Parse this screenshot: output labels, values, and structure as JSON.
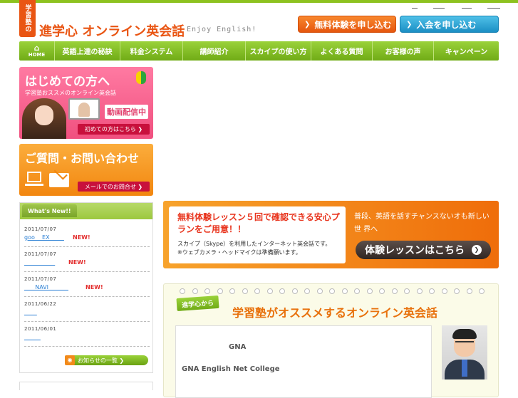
{
  "header": {
    "logo_text": "学習塾の",
    "site_title": "進学心 オンライン英会話",
    "tagline": "Enjoy English!",
    "cta_trial": "無料体験を申し込む",
    "cta_join": "入会を申し込む"
  },
  "nav": {
    "home": "HOME",
    "items": [
      "英語上達の秘訣",
      "料金システム",
      "講師紹介",
      "スカイプの使い方",
      "よくある質問",
      "お客様の声",
      "キャンペーン"
    ]
  },
  "sidebar": {
    "first_banner": {
      "title": "はじめての方へ",
      "subtitle": "学習塾おススメのオンライン英会話",
      "video_label": "動画配信中",
      "button": "初めての方はこちら"
    },
    "contact_banner": {
      "title": "ご質問・お問い合わせ",
      "button": "メールでのお問合せ"
    },
    "news": {
      "heading": "What's New!!",
      "items": [
        {
          "date": "2011/07/07",
          "text": "goo    EX        ",
          "new": "NEW!"
        },
        {
          "date": "2011/07/07",
          "text": "                 ",
          "new": "NEW!"
        },
        {
          "date": "2011/07/07",
          "text": "      NAVI           ",
          "new": "NEW!"
        },
        {
          "date": "2011/06/22",
          "text": "       ",
          "new": ""
        },
        {
          "date": "2011/06/01",
          "text": "         ",
          "new": ""
        }
      ],
      "more": "お知らせの一覧"
    }
  },
  "trial_banner": {
    "headline": "無料体験レッスン５回で確認できる安心プランをご用意！！",
    "desc_line1": "スカイプ（Skype）を利用したインターネット英会話です。",
    "desc_line2": "※ウェブカメラ・ヘッドマイクは準備願います。",
    "side_text": "普段、英語を話すチャンスないオも新しい世 界へ",
    "button": "体験レッスンはこちら"
  },
  "recommend": {
    "badge": "進学心から",
    "title": "学習塾がオススメするオンライン英会話",
    "gna": "GNA",
    "college": "GNA  English Net College"
  },
  "colors": {
    "brand_green": "#8dc21f",
    "brand_orange": "#e95513",
    "accent_pink": "#f0507f",
    "accent_blue": "#1b8fc4"
  }
}
